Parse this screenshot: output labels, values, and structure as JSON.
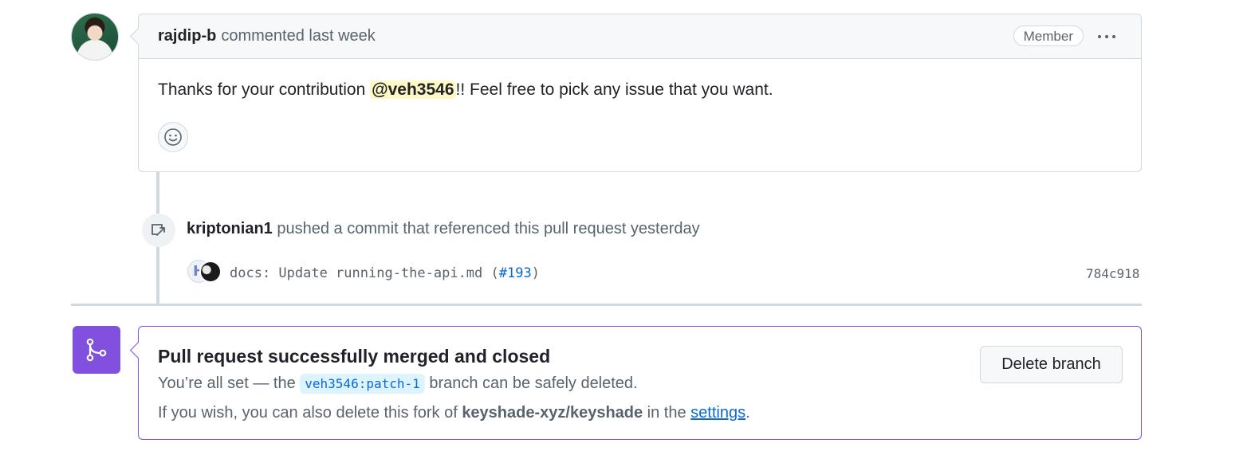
{
  "comment": {
    "author": "rajdip-b",
    "action": "commented last week",
    "badge": "Member",
    "body_before": "Thanks for your contribution ",
    "mention": "@veh3546",
    "body_after": "!! Feel free to pick any issue that you want.",
    "icons": {
      "avatar": "user-avatar",
      "more": "kebab-horizontal-icon",
      "reaction": "smiley-icon"
    }
  },
  "push_event": {
    "author": "kriptonian1",
    "action": "pushed a commit that referenced this pull request yesterday",
    "commit_message_prefix": "docs: Update running-the-api.md (",
    "commit_pr_link": "#193",
    "commit_message_suffix": ")",
    "commit_sha": "784c918",
    "icons": {
      "event": "repo-push-icon",
      "avatar1_text": "H"
    }
  },
  "merge_status": {
    "title": "Pull request successfully merged and closed",
    "line1_before": "You’re all set — the ",
    "branch": "veh3546:patch-1",
    "line1_after": " branch can be safely deleted.",
    "line2_before": "If you wish, you can also delete this fork of ",
    "repo": "keyshade-xyz/keyshade",
    "line2_middle": " in the ",
    "settings_link": "settings",
    "line2_after": ".",
    "delete_button": "Delete branch",
    "accent_color": "#8250df",
    "icons": {
      "merge": "git-merge-icon"
    }
  }
}
